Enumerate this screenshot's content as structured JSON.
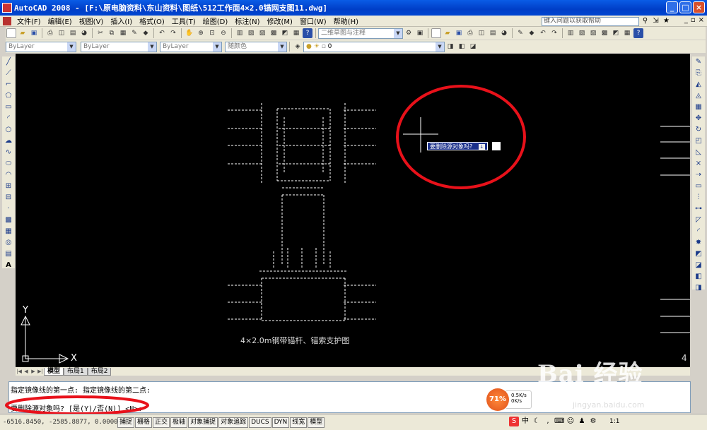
{
  "window": {
    "title": "AutoCAD 2008 - [F:\\原电脑资料\\东山资料\\图纸\\512工作面4×2.0锚网支图11.dwg]",
    "buttons": [
      "_",
      "□",
      "×"
    ]
  },
  "menu": {
    "items": [
      "文件(F)",
      "编辑(E)",
      "视图(V)",
      "插入(I)",
      "格式(O)",
      "工具(T)",
      "绘图(D)",
      "标注(N)",
      "修改(M)",
      "窗口(W)",
      "帮助(H)"
    ],
    "help_search_placeholder": "键入问题以获取帮助"
  },
  "toolbar": {
    "workspace_combo": "二维草图与注释"
  },
  "properties_bar": {
    "color": "ByLayer",
    "linetype": "ByLayer",
    "lineweight": "ByLayer",
    "plotstyle": "随颜色",
    "layer": "0"
  },
  "canvas": {
    "drawing_caption": "4×2.0m钢带锚杆、锚索支护图",
    "tooltip_prompt": "要删除源对象吗?",
    "corner_number": "4",
    "ucs_x": "X",
    "ucs_y": "Y"
  },
  "tabs": [
    "模型",
    "布局1",
    "布局2"
  ],
  "command": {
    "line1": "指定镜像线的第一点: 指定镜像线的第二点:",
    "line2": "要删除源对象吗? [是(Y)/否(N)] <N>:"
  },
  "status": {
    "coordinates": "-6516.8450, -2585.8877, 0.0000",
    "toggles": [
      "捕捉",
      "栅格",
      "正交",
      "极轴",
      "对象捕捉",
      "对象追踪",
      "DUCS",
      "DYN",
      "线宽",
      "模型"
    ],
    "scale": "1:1"
  },
  "speed_widget": {
    "percent": "71%",
    "upload": "0.5K/s",
    "download": "0K/s"
  },
  "watermark": {
    "logo": "Bai 经验",
    "url": "jingyan.baidu.com"
  },
  "colors": {
    "canvas_bg": "#000000",
    "drawing_lines": "#ffffff",
    "annotation_circle": "#e8111a",
    "xp_title_blue": "#0a5ce6"
  }
}
